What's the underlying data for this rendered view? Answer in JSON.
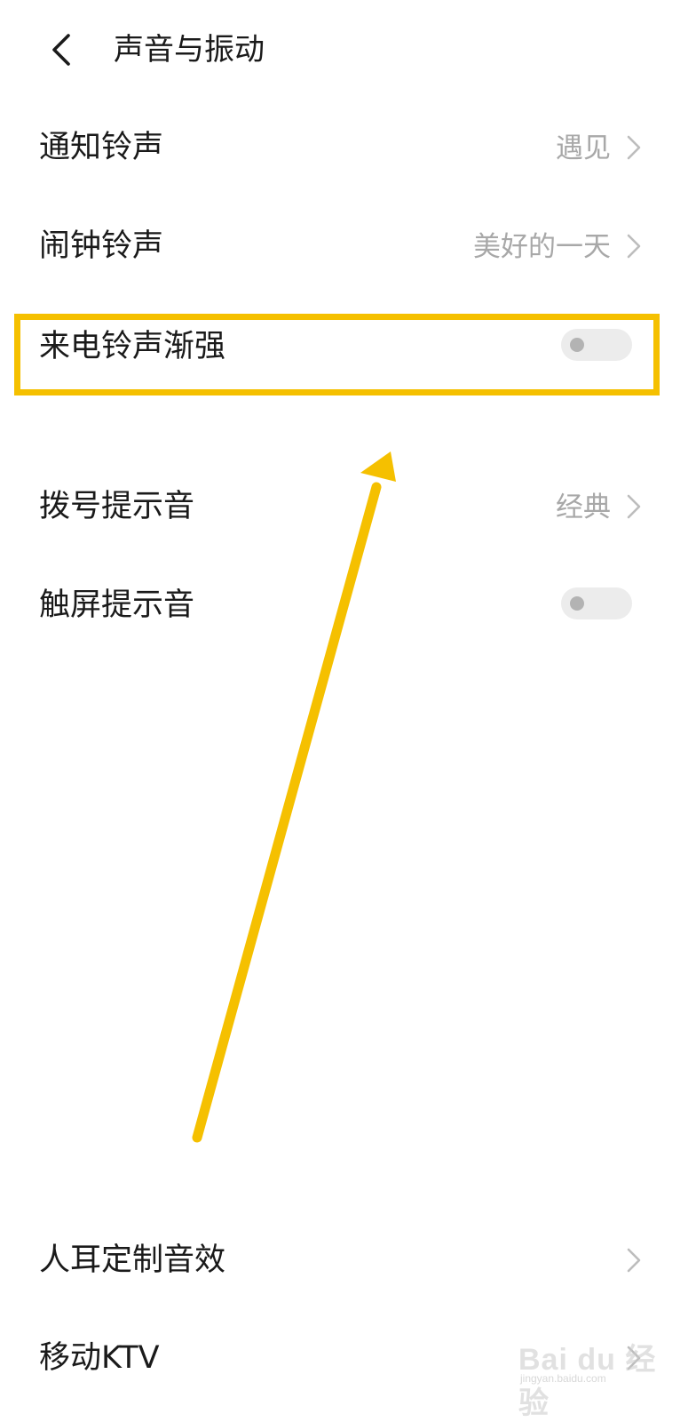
{
  "header": {
    "title": "声音与振动",
    "back_icon": "chevron-left-icon"
  },
  "rows": [
    {
      "label": "通知铃声",
      "value": "遇见",
      "type": "link"
    },
    {
      "label": "闹钟铃声",
      "value": "美好的一天",
      "type": "link"
    },
    {
      "label": "来电铃声渐强",
      "type": "toggle",
      "on": false
    },
    {
      "label": "拨号提示音",
      "value": "经典",
      "type": "link"
    },
    {
      "label": "触屏提示音",
      "type": "toggle",
      "on": false
    },
    {
      "label": "人耳定制音效",
      "type": "link"
    },
    {
      "label": "移动KTV",
      "type": "link"
    }
  ],
  "annotation": {
    "color": "#f5c000",
    "highlight_target": "来电铃声渐强"
  },
  "watermark": {
    "text": "Bai du 经验",
    "sub": "jingyan.baidu.com"
  },
  "colors": {
    "text": "#1a1a1a",
    "secondary": "#a8a8a8",
    "toggle_track": "#ececec",
    "toggle_knob": "#b3b3b3"
  }
}
